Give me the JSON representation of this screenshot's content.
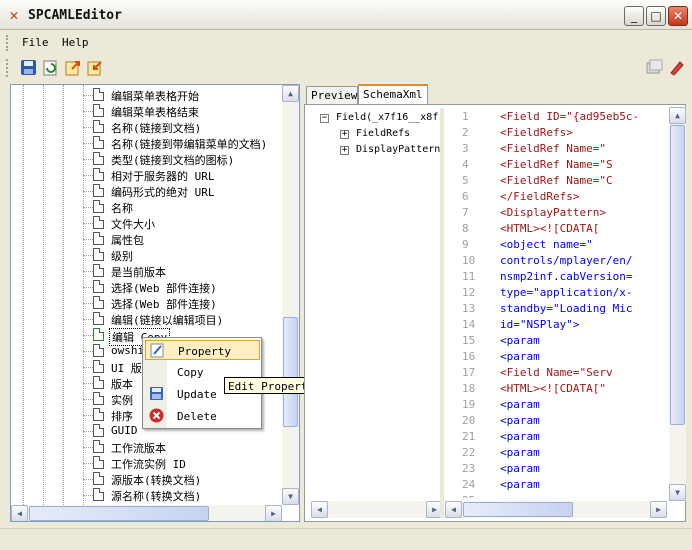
{
  "window": {
    "title": "SPCAMLEditor",
    "minimize": "_",
    "maximize": "□",
    "close": "✕"
  },
  "menu": {
    "file": "File",
    "help": "Help"
  },
  "toolbar": {
    "buttons": [
      "save-icon",
      "refresh-icon",
      "export-icon",
      "import-icon"
    ],
    "right_buttons": [
      "window-icon",
      "edit-icon"
    ]
  },
  "left_tree": {
    "items": [
      "编辑菜单表格开始",
      "编辑菜单表格结束",
      "名称(链接到文档)",
      "名称(链接到带编辑菜单的文档)",
      "类型(链接到文档的图标)",
      "相对于服务器的 URL",
      "编码形式的绝对 URL",
      "名称",
      "文件大小",
      "属性包",
      "级别",
      "是当前版本",
      "选择(Web 部件连接)",
      "选择(Web 部件连接)",
      "编辑(链接以编辑项目)",
      "编辑 Copy",
      "owshi",
      "UI 版",
      "版本",
      "实例",
      "排序",
      "GUID",
      "工作流版本",
      "工作流实例 ID",
      "源版本(转换文档)",
      "源名称(转换文档)"
    ],
    "selected_index": 15
  },
  "context_menu": {
    "items": [
      {
        "label": "Property",
        "icon": "property-icon"
      },
      {
        "label": "Copy",
        "icon": "copy-icon"
      },
      {
        "label": "Update",
        "icon": "update-icon"
      },
      {
        "label": "Delete",
        "icon": "delete-icon"
      }
    ],
    "tooltip": "Edit Property"
  },
  "tabs": [
    {
      "label": "Preview",
      "active": false
    },
    {
      "label": "SchemaXml",
      "active": true
    }
  ],
  "xml_tree": {
    "root": "Field(_x7f16__x8f",
    "children": [
      "FieldRefs",
      "DisplayPattern"
    ]
  },
  "code": {
    "line_numbers": [
      "1",
      "2",
      "3",
      "4",
      "5",
      "6",
      "7",
      "8",
      "9",
      "10",
      "11",
      "12",
      "13",
      "14",
      "15",
      "16",
      "17",
      "18",
      "19",
      "20",
      "21",
      "22",
      "23",
      "24",
      "25"
    ],
    "lines": [
      [
        "<Field ID=\"{ad95eb5c-",
        "tag"
      ],
      [
        "  <FieldRefs>",
        "tag"
      ],
      [
        "    <FieldRef Name=\"",
        "tag"
      ],
      [
        "    <FieldRef Name=\"S",
        "tag"
      ],
      [
        "    <FieldRef Name=\"C",
        "tag"
      ],
      [
        "  </FieldRefs>",
        "tag"
      ],
      [
        "  <DisplayPattern>",
        "tag"
      ],
      [
        "    <HTML><![CDATA[",
        "tag"
      ],
      [
        "       <object name=\"",
        "val"
      ],
      [
        "controls/mplayer/en/",
        "val"
      ],
      [
        "nsmp2inf.cabVersion=",
        "val"
      ],
      [
        "type=\"application/x-",
        "val"
      ],
      [
        "standby=\"Loading Mic",
        "val"
      ],
      [
        "id=\"NSPlay\">",
        "val"
      ],
      [
        "                <param",
        "val"
      ],
      [
        "                <param",
        "val"
      ],
      [
        "    <Field Name=\"Serv",
        "tag"
      ],
      [
        "    <HTML><![CDATA[\"",
        "tag"
      ],
      [
        "                <param",
        "val"
      ],
      [
        "                <param",
        "val"
      ],
      [
        "                <param",
        "val"
      ],
      [
        "                <param",
        "val"
      ],
      [
        "                <param",
        "val"
      ],
      [
        "                <param",
        "val"
      ],
      [
        "                <param",
        "val"
      ]
    ]
  }
}
